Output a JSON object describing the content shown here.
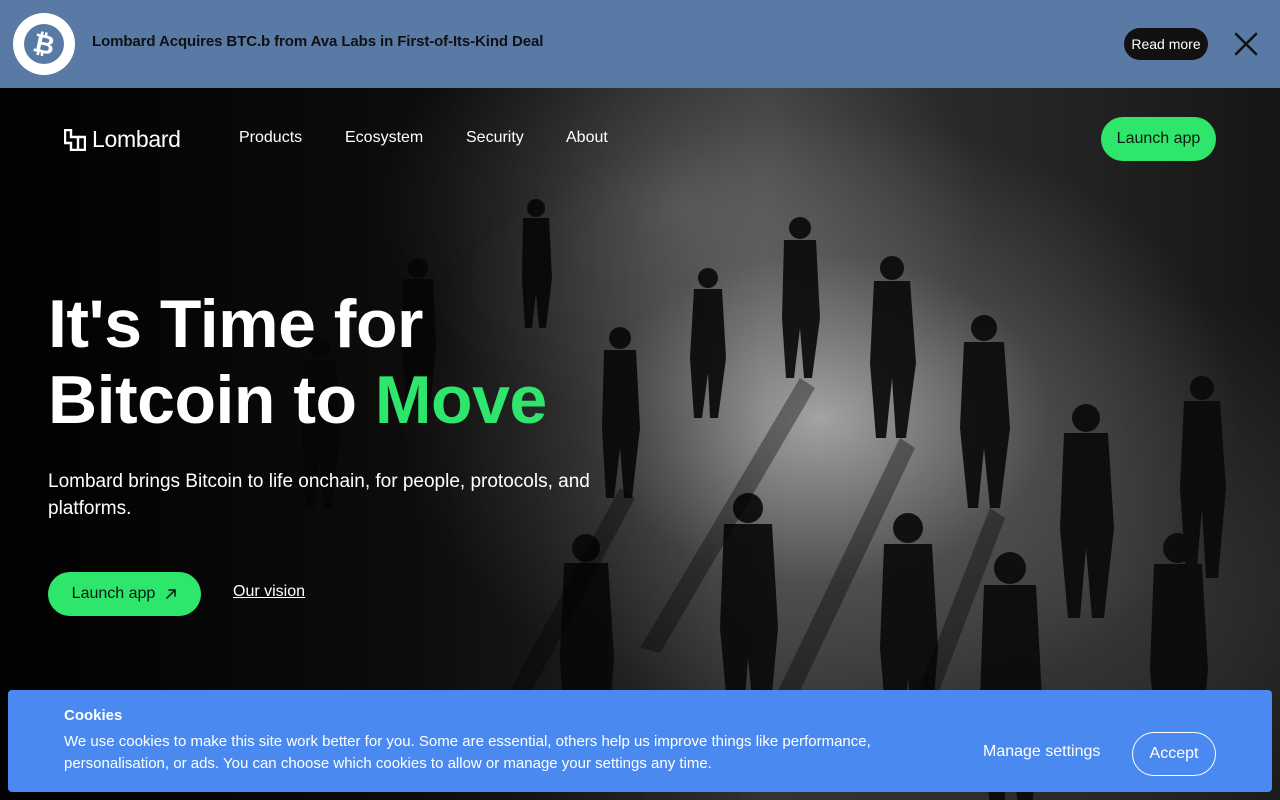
{
  "banner": {
    "text": "Lombard Acquires BTC.b from Ava Labs in First-of-Its-Kind Deal",
    "read_more": "Read more",
    "icon": "bitcoin-icon",
    "close_icon": "close-icon",
    "background": "#5a7aa6"
  },
  "nav": {
    "logo_text": "Lombard",
    "items": [
      "Products",
      "Ecosystem",
      "Security",
      "About"
    ],
    "launch_label": "Launch app"
  },
  "hero": {
    "headline_line1": "It's Time for",
    "headline_line2_prefix": "Bitcoin to ",
    "headline_accent": "Move",
    "subtitle": "Lombard brings Bitcoin to life onchain, for people, protocols, and platforms.",
    "cta_launch": "Launch app",
    "cta_vision": "Our vision",
    "accent_color": "#2ee66b"
  },
  "cookies": {
    "title": "Cookies",
    "text": "We use cookies to make this site work better for you. Some are essential, others help us improve things like performance, personalisation, or ads. You can choose which cookies to allow or manage your settings any time.",
    "manage_label": "Manage settings",
    "accept_label": "Accept",
    "background": "#4a8af0"
  }
}
